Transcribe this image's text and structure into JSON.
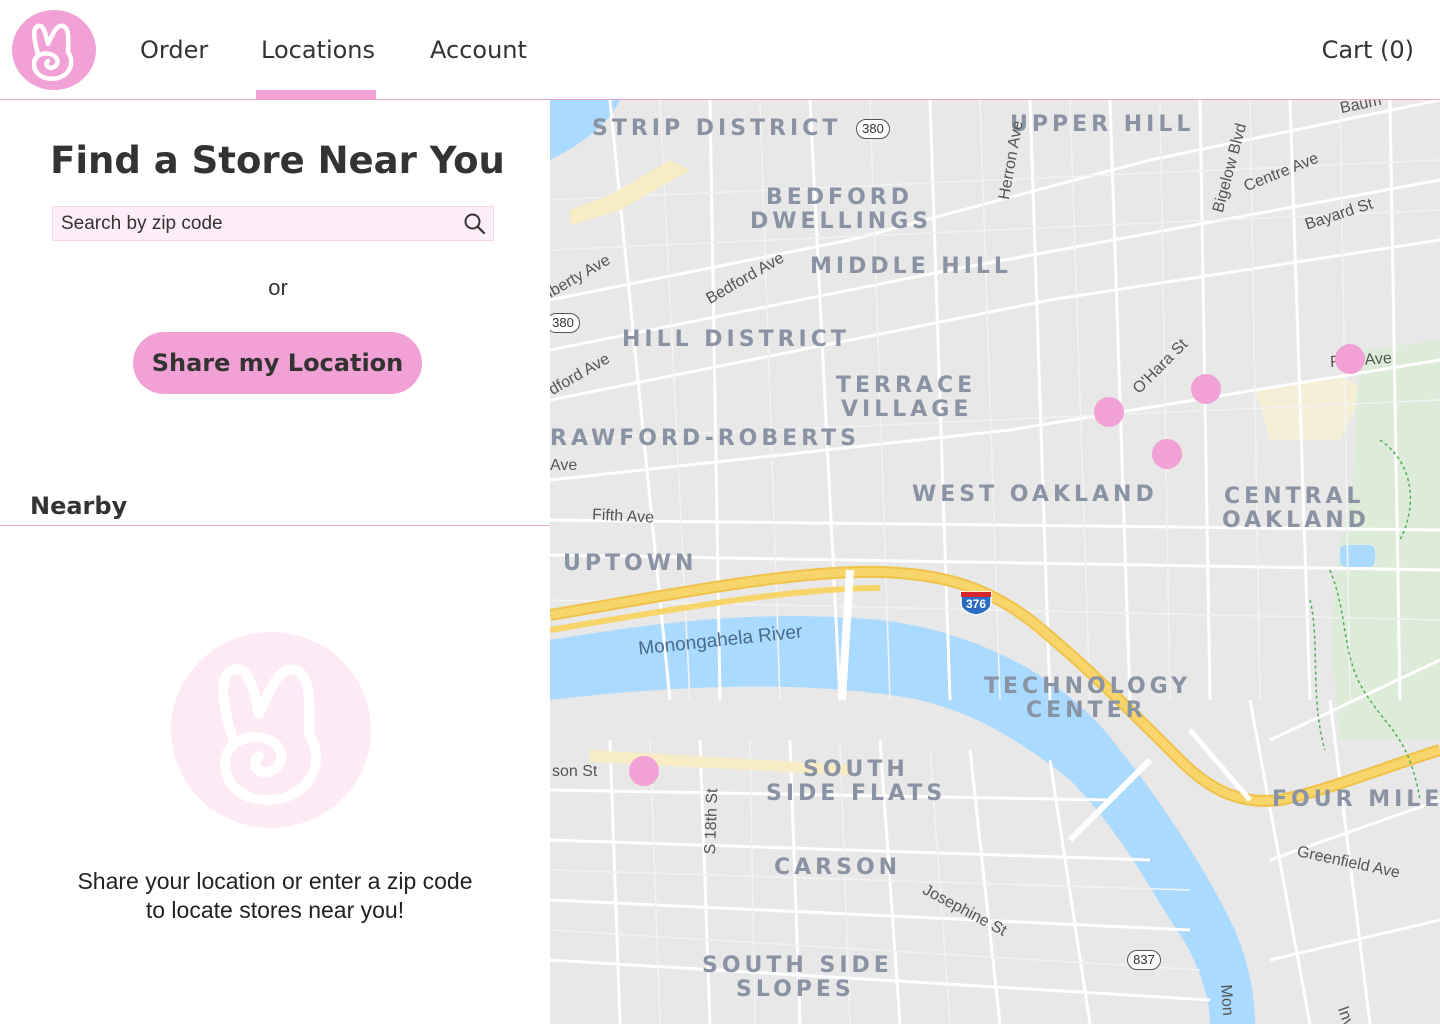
{
  "header": {
    "logo_icon": "bunny-logo-icon",
    "nav": {
      "order": "Order",
      "locations": "Locations",
      "account": "Account"
    },
    "cart": "Cart (0)"
  },
  "panel": {
    "title": "Find a Store Near You",
    "search": {
      "placeholder": "Search by zip code",
      "value": "",
      "icon": "search-icon"
    },
    "or": "or",
    "share_button": "Share my Location",
    "nearby_heading": "Nearby",
    "empty_message_line1": "Share your location or enter a zip code",
    "empty_message_line2": "to locate stores near you!"
  },
  "map": {
    "neighborhoods": {
      "strip_district": "STRIP DISTRICT",
      "upper_hill": "UPPER HILL",
      "bedford_1": "BEDFORD",
      "bedford_2": "DWELLINGS",
      "middle_hill": "MIDDLE HILL",
      "hill_district": "HILL DISTRICT",
      "terrace_1": "TERRACE",
      "terrace_2": "VILLAGE",
      "crawford": "RAWFORD-ROBERTS",
      "west_oakland": "WEST OAKLAND",
      "central_1": "CENTRAL",
      "central_2": "OAKLAND",
      "uptown": "UPTOWN",
      "tech_1": "TECHNOLOGY",
      "tech_2": "CENTER",
      "south_flats_1": "SOUTH",
      "south_flats_2": "SIDE FLATS",
      "carson": "CARSON",
      "four_mile": "FOUR MILE",
      "slopes_1": "SOUTH SIDE",
      "slopes_2": "SLOPES"
    },
    "streets": {
      "liberty": "iberty Ave",
      "bedford": "Bedford Ave",
      "bedford2": "dford Ave",
      "herron": "Herron Ave",
      "bigelow": "Bigelow Blvd",
      "centre": "Centre Ave",
      "bayard": "Bayard St",
      "baum": "Baum",
      "ohara": "O'Hara St",
      "forbes": "F    es Ave",
      "fifth": "Fifth Ave",
      "ave": "Ave",
      "carson": "son St",
      "s18th": "S 18th St",
      "josephine": "Josephine St",
      "greenfield": "Greenfield Ave",
      "mon": "Mon",
      "inv": "Inv"
    },
    "river": "Monongahela River",
    "routes": {
      "r380a": "380",
      "r380b": "380",
      "i376": "376",
      "r837": "837"
    },
    "colors": {
      "accent": "#f2a1d6",
      "water": "#aadaff",
      "highway": "#f8d56b",
      "land": "#e8e8e8"
    }
  }
}
